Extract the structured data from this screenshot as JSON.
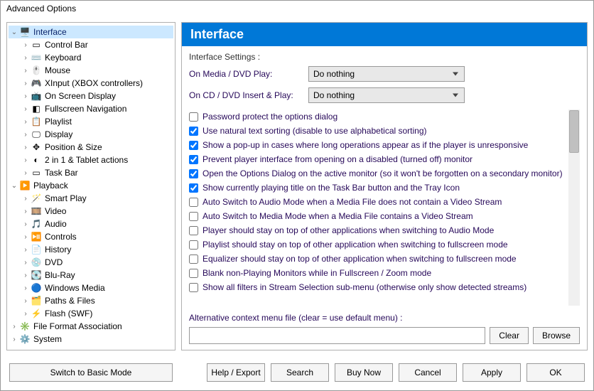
{
  "window": {
    "title": "Advanced Options"
  },
  "tree": [
    {
      "label": "Interface",
      "level": 0,
      "expanded": true,
      "selected": true,
      "icon": "🖥️"
    },
    {
      "label": "Control Bar",
      "level": 1,
      "icon": "▭"
    },
    {
      "label": "Keyboard",
      "level": 1,
      "icon": "⌨️"
    },
    {
      "label": "Mouse",
      "level": 1,
      "icon": "🖱️"
    },
    {
      "label": "XInput (XBOX controllers)",
      "level": 1,
      "icon": "🎮"
    },
    {
      "label": "On Screen Display",
      "level": 1,
      "icon": "📺"
    },
    {
      "label": "Fullscreen Navigation",
      "level": 1,
      "icon": "◧"
    },
    {
      "label": "Playlist",
      "level": 1,
      "icon": "📋"
    },
    {
      "label": "Display",
      "level": 1,
      "icon": "🖵"
    },
    {
      "label": "Position & Size",
      "level": 1,
      "icon": "✥"
    },
    {
      "label": "2 in 1 & Tablet actions",
      "level": 1,
      "icon": "◐"
    },
    {
      "label": "Task Bar",
      "level": 1,
      "icon": "▭"
    },
    {
      "label": "Playback",
      "level": 0,
      "expanded": true,
      "icon": "▶️"
    },
    {
      "label": "Smart Play",
      "level": 1,
      "icon": "🪄"
    },
    {
      "label": "Video",
      "level": 1,
      "icon": "🎞️"
    },
    {
      "label": "Audio",
      "level": 1,
      "icon": "🎵"
    },
    {
      "label": "Controls",
      "level": 1,
      "icon": "⏯️"
    },
    {
      "label": "History",
      "level": 1,
      "icon": "📄"
    },
    {
      "label": "DVD",
      "level": 1,
      "icon": "💿"
    },
    {
      "label": "Blu-Ray",
      "level": 1,
      "icon": "💽"
    },
    {
      "label": "Windows Media",
      "level": 1,
      "icon": "🔵"
    },
    {
      "label": "Paths & Files",
      "level": 1,
      "icon": "🗂️"
    },
    {
      "label": "Flash (SWF)",
      "level": 1,
      "icon": "⚡"
    },
    {
      "label": "File Format Association",
      "level": 0,
      "expanded": false,
      "icon": "✳️"
    },
    {
      "label": "System",
      "level": 0,
      "expanded": false,
      "icon": "⚙️"
    }
  ],
  "panel": {
    "heading": "Interface",
    "section_label": "Interface Settings :",
    "rows": [
      {
        "label": "On Media / DVD Play:",
        "value": "Do nothing"
      },
      {
        "label": "On CD / DVD Insert & Play:",
        "value": "Do nothing"
      }
    ],
    "checks": [
      {
        "checked": false,
        "label": "Password protect the options dialog"
      },
      {
        "checked": true,
        "label": "Use natural text sorting (disable to use alphabetical sorting)"
      },
      {
        "checked": true,
        "label": "Show a pop-up in cases where long operations appear as if the player is unresponsive"
      },
      {
        "checked": true,
        "label": "Prevent player interface from opening on a disabled (turned off) monitor"
      },
      {
        "checked": true,
        "label": "Open the Options Dialog on the active monitor (so it won't be forgotten on a secondary monitor)"
      },
      {
        "checked": true,
        "label": "Show currently playing title on the Task Bar button and the Tray Icon"
      },
      {
        "checked": false,
        "label": "Auto Switch to Audio Mode when a Media File does not contain a Video Stream"
      },
      {
        "checked": false,
        "label": "Auto Switch to Media Mode when a Media File contains a Video Stream"
      },
      {
        "checked": false,
        "label": "Player should stay on top of other applications when switching to Audio Mode"
      },
      {
        "checked": false,
        "label": "Playlist should stay on top of other application when switching to fullscreen mode"
      },
      {
        "checked": false,
        "label": "Equalizer should stay on top of other application when switching to fullscreen mode"
      },
      {
        "checked": false,
        "label": "Blank non-Playing Monitors while in Fullscreen / Zoom mode"
      },
      {
        "checked": false,
        "label": "Show all filters in Stream Selection sub-menu (otherwise only show detected streams)"
      }
    ],
    "alt": {
      "label": "Alternative context menu file (clear = use default menu) :",
      "value": "",
      "clear": "Clear",
      "browse": "Browse"
    }
  },
  "footer": {
    "switch": "Switch to Basic Mode",
    "buttons": [
      "Help / Export",
      "Search",
      "Buy Now",
      "Cancel",
      "Apply",
      "OK"
    ]
  }
}
